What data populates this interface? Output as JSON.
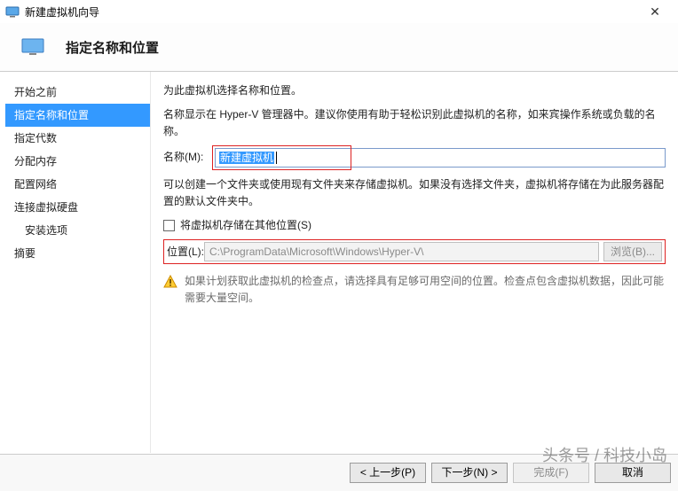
{
  "window": {
    "title": "新建虚拟机向导"
  },
  "header": {
    "title": "指定名称和位置"
  },
  "sidebar": {
    "items": [
      {
        "label": "开始之前"
      },
      {
        "label": "指定名称和位置"
      },
      {
        "label": "指定代数"
      },
      {
        "label": "分配内存"
      },
      {
        "label": "配置网络"
      },
      {
        "label": "连接虚拟硬盘"
      },
      {
        "label": "安装选项"
      },
      {
        "label": "摘要"
      }
    ]
  },
  "content": {
    "intro": "为此虚拟机选择名称和位置。",
    "name_hint": "名称显示在 Hyper-V 管理器中。建议你使用有助于轻松识别此虚拟机的名称，如来宾操作系统或负载的名称。",
    "name_label": "名称(M):",
    "name_value": "新建虚拟机",
    "loc_hint": "可以创建一个文件夹或使用现有文件夹来存储虚拟机。如果没有选择文件夹，虚拟机将存储在为此服务器配置的默认文件夹中。",
    "store_other_label": "将虚拟机存储在其他位置(S)",
    "loc_label": "位置(L):",
    "loc_value": "C:\\ProgramData\\Microsoft\\Windows\\Hyper-V\\",
    "browse_label": "浏览(B)...",
    "warning_text": "如果计划获取此虚拟机的检查点，请选择具有足够可用空间的位置。检查点包含虚拟机数据，因此可能需要大量空间。"
  },
  "buttons": {
    "prev": "< 上一步(P)",
    "next": "下一步(N) >",
    "finish": "完成(F)",
    "cancel": "取消"
  },
  "watermark": "头条号 / 科技小岛"
}
